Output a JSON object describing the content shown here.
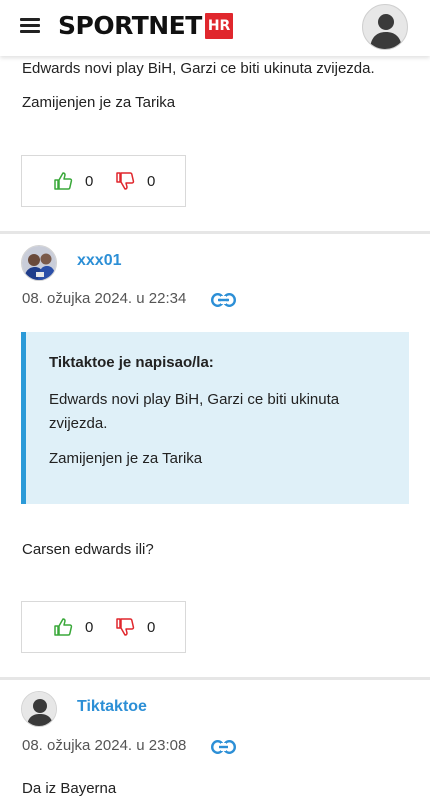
{
  "header": {
    "logo_text": "SPORTNET",
    "logo_badge": "HR",
    "brand_color": "#e0272d",
    "menu_icon": "hamburger-menu-icon",
    "avatar_icon": "user-avatar-icon"
  },
  "comment_prev": {
    "text1": "Edwards novi play BiH, Garzi ce biti ukinuta zvijezda.",
    "text2": "Zamijenjen je za Tarika",
    "likes": "0",
    "dislikes": "0"
  },
  "comment1": {
    "username": "xxx01",
    "timestamp": "08. ožujka 2024. u 22:34",
    "quote_author": "Tiktaktoe je napisao/la:",
    "quote_line1": "Edwards novi play BiH, Garzi ce biti ukinuta",
    "quote_line2": "zvijezda.",
    "quote_line3": "Zamijenjen je za Tarika",
    "text": "Carsen edwards ili?",
    "likes": "0",
    "dislikes": "0"
  },
  "comment2": {
    "username": "Tiktaktoe",
    "timestamp": "08. ožujka 2024. u 23:08",
    "text": "Da iz Bayerna"
  },
  "colors": {
    "link": "#2c8fd6",
    "quote_bg": "#dff0f8",
    "quote_border": "#2b9ad8",
    "like": "#3aa83a",
    "dislike": "#e0272d"
  }
}
